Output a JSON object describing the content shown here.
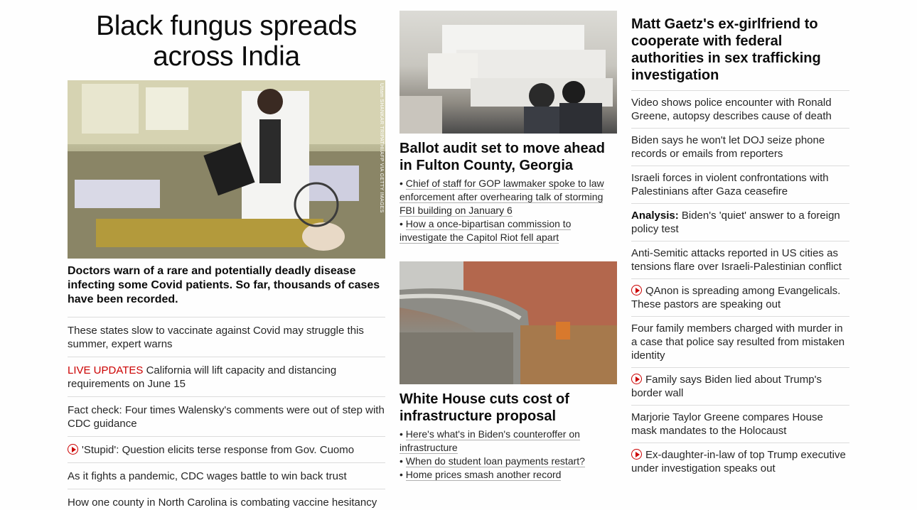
{
  "col1": {
    "headline": "Black fungus spreads across India",
    "image_credit": "Uttam SHANKAR TRIPATHI/AFP VIA GETTY IMAGES",
    "lede": "Doctors warn of a rare and potentially deadly disease infecting some Covid patients. So far, thousands of cases have been recorded.",
    "items": [
      {
        "text": "These states slow to vaccinate against Covid may struggle this summer, expert warns"
      },
      {
        "prefix": "LIVE UPDATES",
        "text": " California will lift capacity and distancing requirements on June 15"
      },
      {
        "text": "Fact check: Four times Walensky's comments were out of step with CDC guidance"
      },
      {
        "text": "'Stupid': Question elicits terse response from Gov. Cuomo",
        "video": true
      },
      {
        "text": "As it fights a pandemic, CDC wages battle to win back trust"
      },
      {
        "text": "How one county in North Carolina is combating vaccine hesitancy"
      }
    ]
  },
  "col2": {
    "card1": {
      "title": "Ballot audit set to move ahead in Fulton County, Georgia",
      "bullets": [
        "Chief of staff for GOP lawmaker spoke to law enforcement after overhearing talk of storming FBI building on January 6",
        "How a once-bipartisan commission to investigate the Capitol Riot fell apart"
      ]
    },
    "card2": {
      "title": "White House cuts cost of infrastructure proposal",
      "bullets": [
        "Here's what's in Biden's counteroffer on infrastructure",
        "When do student loan payments restart?",
        "Home prices smash another record"
      ]
    }
  },
  "col3": {
    "headline": "Matt Gaetz's ex-girlfriend to cooperate with federal authorities in sex trafficking investigation",
    "items": [
      {
        "text": "Video shows police encounter with Ronald Greene, autopsy describes cause of death"
      },
      {
        "text": "Biden says he won't let DOJ seize phone records or emails from reporters"
      },
      {
        "text": "Israeli forces in violent confrontations with Palestinians after Gaza ceasefire"
      },
      {
        "label": "Analysis:",
        "text": " Biden's 'quiet' answer to a foreign policy test"
      },
      {
        "text": "Anti-Semitic attacks reported in US cities as tensions flare over Israeli-Palestinian conflict"
      },
      {
        "text": "QAnon is spreading among Evangelicals. These pastors are speaking out",
        "video": true
      },
      {
        "text": "Four family members charged with murder in a case that police say resulted from mistaken identity"
      },
      {
        "text": "Family says Biden lied about Trump's border wall",
        "video": true
      },
      {
        "text": "Marjorie Taylor Greene compares House mask mandates to the Holocaust"
      },
      {
        "text": "Ex-daughter-in-law of top Trump executive under investigation speaks out",
        "video": true
      }
    ]
  },
  "colors": {
    "live": "#cc0000",
    "video_icon": "#cc0000",
    "text": "#262626",
    "divider": "#dcdcdc"
  }
}
